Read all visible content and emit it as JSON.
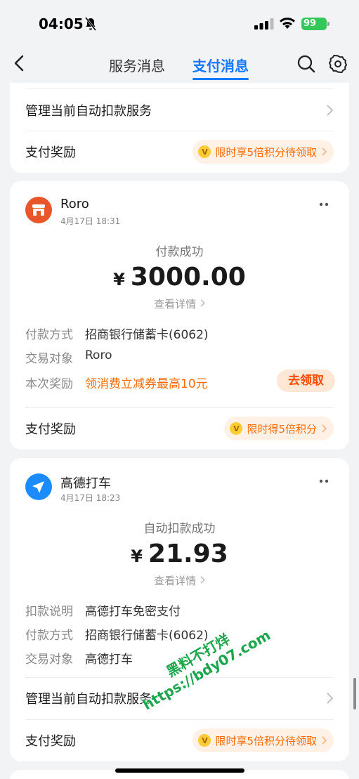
{
  "status": {
    "time": "04:05",
    "battery": "99"
  },
  "nav": {
    "tabs": [
      "服务消息",
      "支付消息"
    ],
    "active": "支付消息"
  },
  "card0": {
    "manage_label": "管理当前自动扣款服务",
    "reward_label": "支付奖励",
    "reward_pill": "限时享5倍积分待领取"
  },
  "card1": {
    "merchant": "Roro",
    "time": "4月17日 18:31",
    "status": "付款成功",
    "currency": "¥",
    "amount": "3000.00",
    "detail_link": "查看详情",
    "fields": [
      {
        "k": "付款方式",
        "v": "招商银行储蓄卡(6062)"
      },
      {
        "k": "交易对象",
        "v": "Roro"
      },
      {
        "k": "本次奖励",
        "v": "领消费立减券最高10元"
      }
    ],
    "claim_button": "去领取",
    "reward_label": "支付奖励",
    "reward_pill": "限时得5倍积分"
  },
  "card2": {
    "merchant": "高德打车",
    "time": "4月17日 18:23",
    "status": "自动扣款成功",
    "currency": "¥",
    "amount": "21.93",
    "detail_link": "查看详情",
    "fields": [
      {
        "k": "扣款说明",
        "v": "高德打车免密支付"
      },
      {
        "k": "付款方式",
        "v": "招商银行储蓄卡(6062)"
      },
      {
        "k": "交易对象",
        "v": "高德打车"
      }
    ],
    "manage_label": "管理当前自动扣款服务",
    "reward_label": "支付奖励",
    "reward_pill": "限时享5倍积分待领取"
  },
  "watermark": {
    "line1": "黑料不打烊",
    "line2": "https://bdy07.com"
  },
  "colors": {
    "accent": "#1677ff",
    "reward_orange": "#ff6a00",
    "background": "#f2f3f5"
  }
}
